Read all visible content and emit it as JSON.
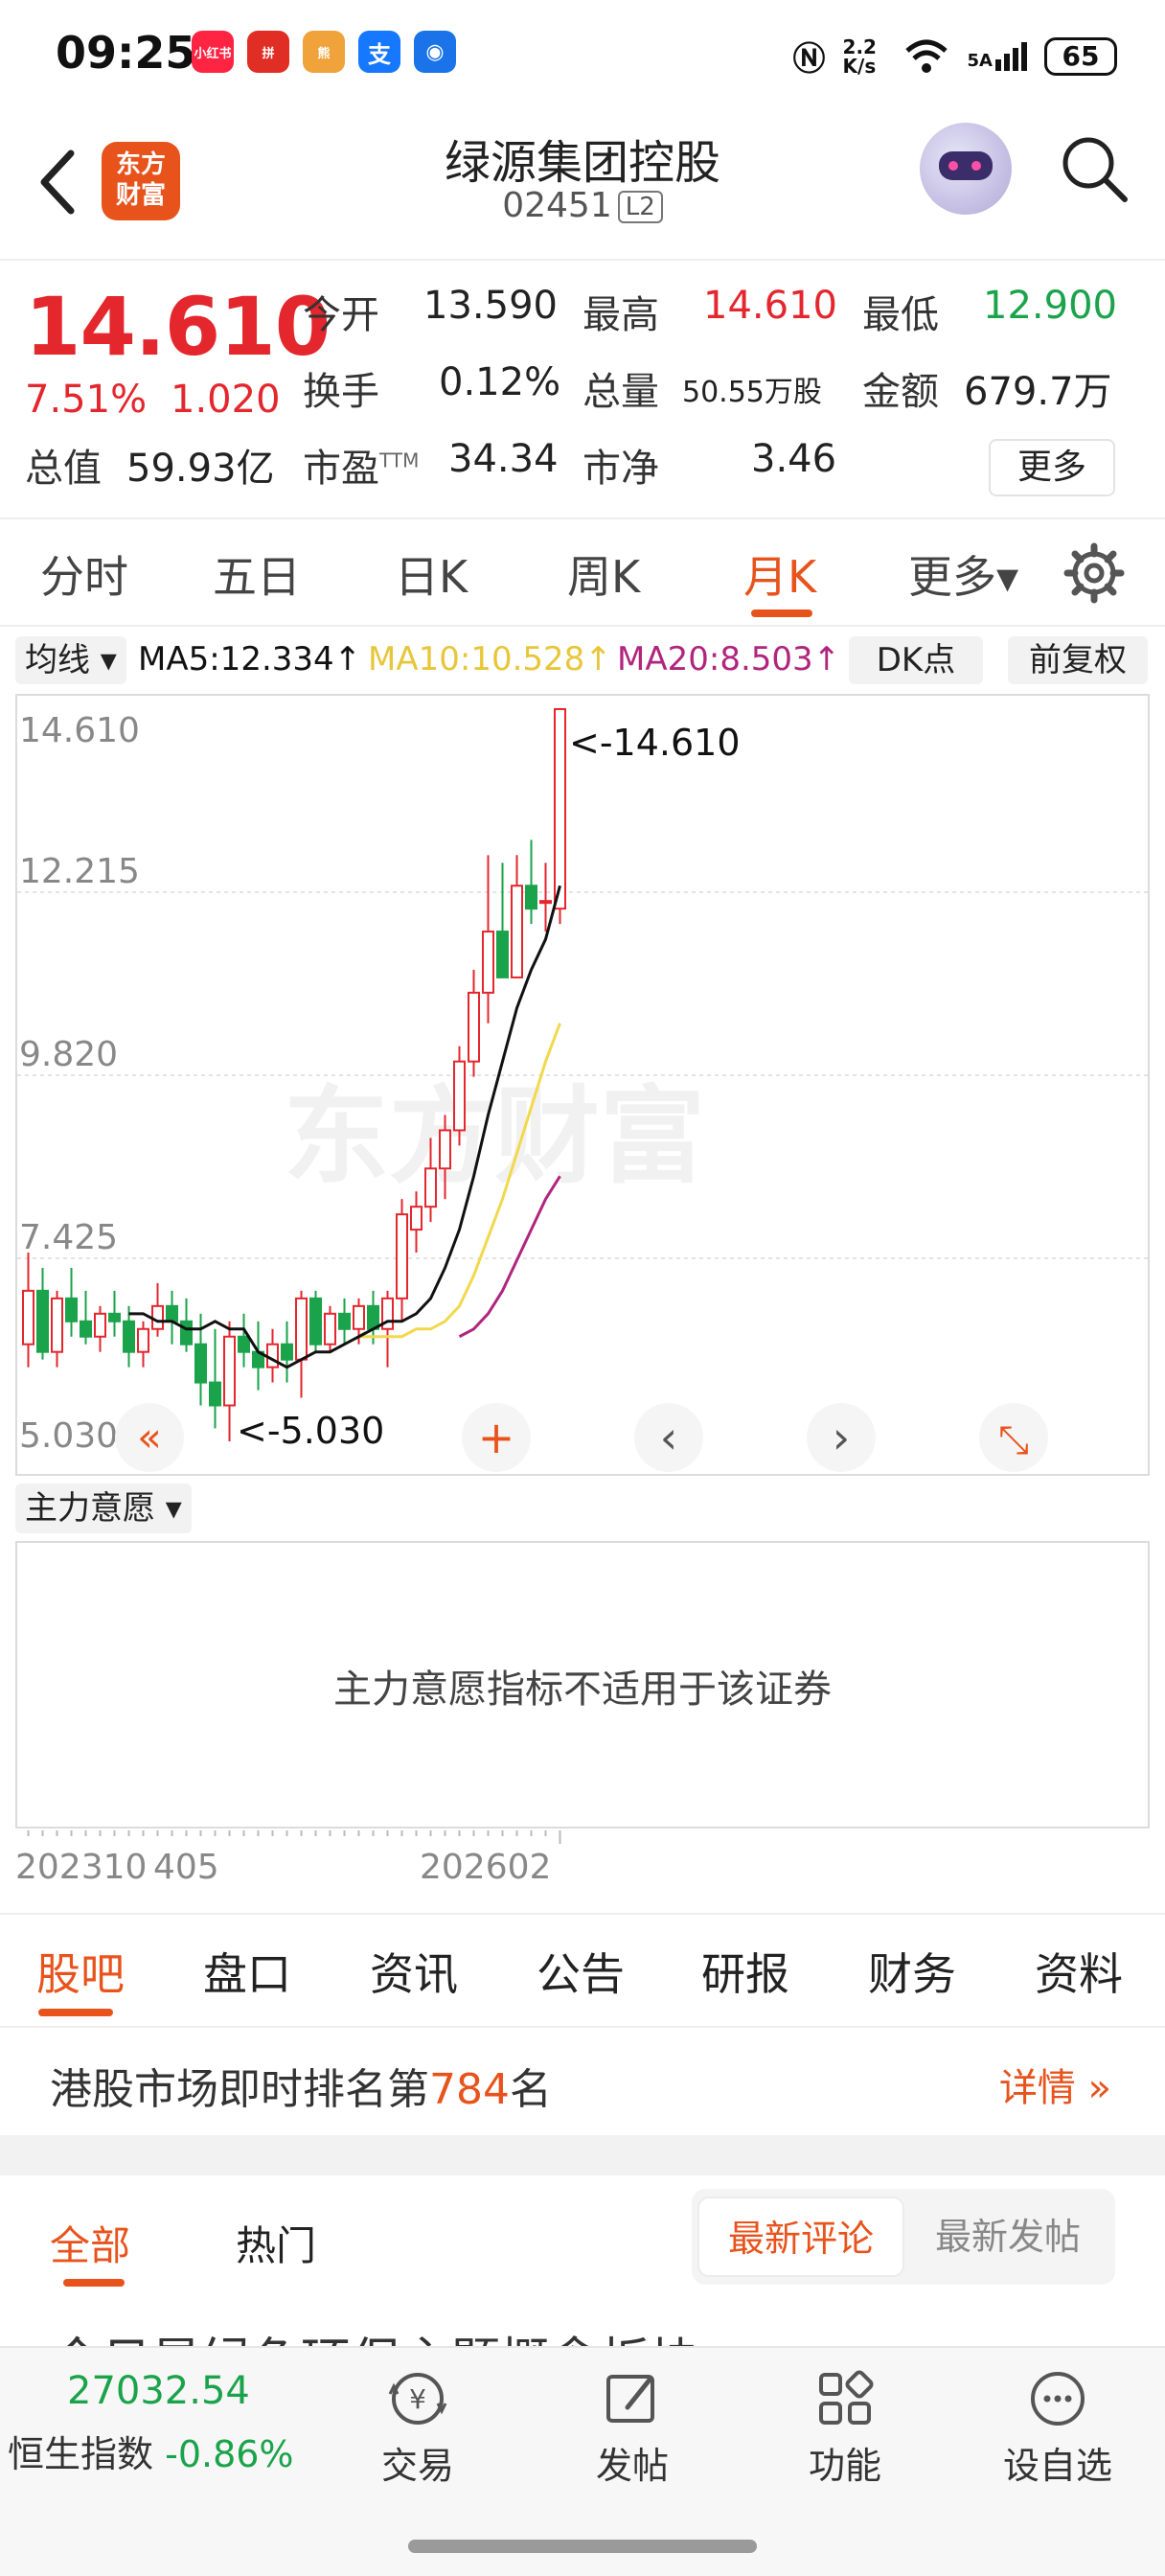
{
  "status": {
    "time": "09:25",
    "apps": [
      {
        "label": "小红书",
        "color": "#ff2442"
      },
      {
        "label": "拼",
        "color": "#e02e24"
      },
      {
        "label": "熊",
        "color": "#f0a23b"
      },
      {
        "label": "支",
        "color": "#1677ff"
      },
      {
        "label": "◉",
        "color": "#1a73e8"
      }
    ],
    "net_speed": "2.2 K/s",
    "signal": "5A",
    "battery": "65"
  },
  "header": {
    "logo_line1": "东方",
    "logo_line2": "财富",
    "stock_name": "绿源集团控股",
    "stock_code": "02451",
    "level_badge": "L2"
  },
  "quote": {
    "price": "14.610",
    "change_pct": "7.51%",
    "change_abs": "1.020",
    "open_label": "今开",
    "open": "13.590",
    "high_label": "最高",
    "high": "14.610",
    "low_label": "最低",
    "low": "12.900",
    "turnover_label": "换手",
    "turnover": "0.12%",
    "volume_label": "总量",
    "volume": "50.55万股",
    "amount_label": "金额",
    "amount": "679.7万",
    "mktcap_label": "总值",
    "mktcap": "59.93亿",
    "pe_label": "市盈",
    "pe_sup": "TTM",
    "pe": "34.34",
    "pb_label": "市净",
    "pb": "3.46",
    "more_label": "更多"
  },
  "period_tabs": [
    "分时",
    "五日",
    "日K",
    "周K",
    "月K",
    "更多▾"
  ],
  "active_period": "月K",
  "ma": {
    "select_label": "均线 ▾",
    "ma5": "MA5:12.334↑",
    "ma10": "MA10:10.528↑",
    "ma20": "MA20:8.503↑",
    "dk_label": "DK点",
    "adjust_label": "前复权"
  },
  "colors": {
    "accent": "#e8531c",
    "up": "#e4262d",
    "down": "#1aa34a",
    "ma5": "#111111",
    "ma10": "#f2d84b",
    "ma20": "#b0257d"
  },
  "chart_data": {
    "type": "candlestick",
    "period": "monthly",
    "y_ticks": [
      "14.610",
      "12.215",
      "9.820",
      "7.425",
      "5.030"
    ],
    "ylim": [
      5.03,
      14.61
    ],
    "max_label": "<-14.610",
    "min_label": "<-5.030",
    "watermark": "东方财富",
    "candles": [
      {
        "o": 6.3,
        "h": 7.5,
        "l": 6.0,
        "c": 7.0
      },
      {
        "o": 7.0,
        "h": 7.3,
        "l": 6.1,
        "c": 6.2
      },
      {
        "o": 6.2,
        "h": 7.0,
        "l": 6.0,
        "c": 6.9
      },
      {
        "o": 6.9,
        "h": 7.3,
        "l": 6.4,
        "c": 6.6
      },
      {
        "o": 6.6,
        "h": 7.0,
        "l": 6.3,
        "c": 6.4
      },
      {
        "o": 6.4,
        "h": 6.8,
        "l": 6.2,
        "c": 6.7
      },
      {
        "o": 6.7,
        "h": 7.0,
        "l": 6.4,
        "c": 6.6
      },
      {
        "o": 6.6,
        "h": 6.8,
        "l": 6.0,
        "c": 6.2
      },
      {
        "o": 6.2,
        "h": 6.6,
        "l": 6.0,
        "c": 6.5
      },
      {
        "o": 6.5,
        "h": 7.1,
        "l": 6.4,
        "c": 6.8
      },
      {
        "o": 6.8,
        "h": 7.0,
        "l": 6.3,
        "c": 6.6
      },
      {
        "o": 6.6,
        "h": 6.9,
        "l": 6.2,
        "c": 6.3
      },
      {
        "o": 6.3,
        "h": 6.7,
        "l": 5.5,
        "c": 5.8
      },
      {
        "o": 5.8,
        "h": 6.5,
        "l": 5.2,
        "c": 5.5
      },
      {
        "o": 5.5,
        "h": 6.6,
        "l": 5.03,
        "c": 6.4
      },
      {
        "o": 6.4,
        "h": 6.7,
        "l": 6.0,
        "c": 6.2
      },
      {
        "o": 6.2,
        "h": 6.6,
        "l": 5.7,
        "c": 6.0
      },
      {
        "o": 6.0,
        "h": 6.5,
        "l": 5.8,
        "c": 6.3
      },
      {
        "o": 6.3,
        "h": 6.6,
        "l": 5.8,
        "c": 6.1
      },
      {
        "o": 6.1,
        "h": 7.0,
        "l": 5.6,
        "c": 6.9
      },
      {
        "o": 6.9,
        "h": 7.0,
        "l": 6.2,
        "c": 6.3
      },
      {
        "o": 6.3,
        "h": 6.8,
        "l": 6.2,
        "c": 6.7
      },
      {
        "o": 6.7,
        "h": 6.9,
        "l": 6.3,
        "c": 6.5
      },
      {
        "o": 6.5,
        "h": 6.9,
        "l": 6.3,
        "c": 6.8
      },
      {
        "o": 6.8,
        "h": 7.0,
        "l": 6.3,
        "c": 6.5
      },
      {
        "o": 6.5,
        "h": 7.0,
        "l": 6.0,
        "c": 6.9
      },
      {
        "o": 6.9,
        "h": 8.2,
        "l": 6.6,
        "c": 8.0
      },
      {
        "o": 7.8,
        "h": 8.3,
        "l": 7.5,
        "c": 8.1
      },
      {
        "o": 8.1,
        "h": 9.0,
        "l": 7.9,
        "c": 8.6
      },
      {
        "o": 8.6,
        "h": 9.3,
        "l": 8.2,
        "c": 9.1
      },
      {
        "o": 9.1,
        "h": 10.2,
        "l": 8.9,
        "c": 10.0
      },
      {
        "o": 10.0,
        "h": 11.2,
        "l": 9.8,
        "c": 10.9
      },
      {
        "o": 10.9,
        "h": 12.7,
        "l": 10.5,
        "c": 11.7
      },
      {
        "o": 11.7,
        "h": 12.6,
        "l": 11.3,
        "c": 11.1
      },
      {
        "o": 11.1,
        "h": 12.7,
        "l": 11.1,
        "c": 12.3
      },
      {
        "o": 12.3,
        "h": 12.9,
        "l": 11.8,
        "c": 12.0
      },
      {
        "o": 12.1,
        "h": 12.6,
        "l": 11.7,
        "c": 12.1
      },
      {
        "o": 12.0,
        "h": 14.61,
        "l": 11.8,
        "c": 14.61
      }
    ],
    "ma5": [
      6.7,
      6.7,
      6.6,
      6.6,
      6.5,
      6.5,
      6.6,
      6.5,
      6.5,
      6.2,
      6.1,
      6.0,
      6.1,
      6.2,
      6.2,
      6.3,
      6.4,
      6.5,
      6.6,
      6.6,
      6.7,
      6.9,
      7.3,
      7.8,
      8.5,
      9.3,
      10.0,
      10.7,
      11.2,
      11.6,
      12.3
    ],
    "ma10": [
      6.4,
      6.4,
      6.4,
      6.4,
      6.5,
      6.5,
      6.6,
      6.8,
      7.2,
      7.7,
      8.2,
      8.8,
      9.4,
      10.0,
      10.5
    ],
    "ma20": [
      6.4,
      6.5,
      6.7,
      7.0,
      7.4,
      7.8,
      8.2,
      8.5
    ]
  },
  "nav_buttons": [
    "«",
    "+",
    "‹",
    "›",
    "⤡"
  ],
  "sub_indicator": {
    "select_label": "主力意愿 ▾",
    "message": "主力意愿指标不适用于该证券"
  },
  "dates": {
    "start": "202310",
    "mid": "405",
    "end": "202602"
  },
  "section_tabs": [
    "股吧",
    "盘口",
    "资讯",
    "公告",
    "研报",
    "财务",
    "资料"
  ],
  "active_section": "股吧",
  "rank": {
    "prefix": "港股市场即时排名第",
    "number": "784",
    "suffix": "名",
    "more": "详情 »"
  },
  "feed": {
    "tabs": [
      "全部",
      "热门"
    ],
    "sort_latest_comment": "最新评论",
    "sort_latest_post": "最新发帖",
    "peek": "今日是绿色环保主题概念板块"
  },
  "bottom_nav": {
    "index_value": "27032.54",
    "index_name": "恒生指数",
    "index_change": "-0.86%",
    "items": [
      "交易",
      "发帖",
      "功能",
      "设自选"
    ]
  }
}
